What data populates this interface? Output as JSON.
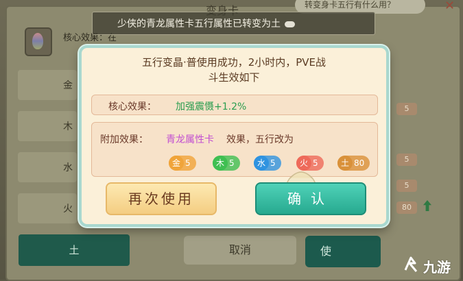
{
  "background": {
    "title": "变身卡",
    "bubble_text": "转变身卡五行有什么用？",
    "core_label": "核心效果：在",
    "row_labels": [
      "金",
      "木",
      "水",
      "火"
    ],
    "earth_tab": "土",
    "cancel_label": "取消",
    "use_label": "使",
    "chip_values": [
      "5",
      "5",
      "5",
      "80"
    ]
  },
  "toast": {
    "text": "少侠的青龙属性卡五行属性已转变为土"
  },
  "dialog": {
    "message_line1": "五行变晶·普使用成功，2小时内，PVE战",
    "message_line2": "斗生效如下",
    "core_effect": {
      "label": "核心效果：",
      "value": "加强震慑+1.2%"
    },
    "extra_effect": {
      "label": "附加效果：",
      "highlight": "青龙属性卡",
      "rest": "效果，五行改为"
    },
    "elements": [
      {
        "name": "金",
        "value": "5",
        "color": "#f0a43a"
      },
      {
        "name": "木",
        "value": "5",
        "color": "#3fbf52"
      },
      {
        "name": "水",
        "value": "5",
        "color": "#2f93e0"
      },
      {
        "name": "火",
        "value": "5",
        "color": "#ee6a5a"
      },
      {
        "name": "土",
        "value": "80",
        "color": "#d9913a"
      }
    ],
    "again_button": "再次使用",
    "confirm_button": "确认"
  },
  "watermark": {
    "text": "九游"
  }
}
